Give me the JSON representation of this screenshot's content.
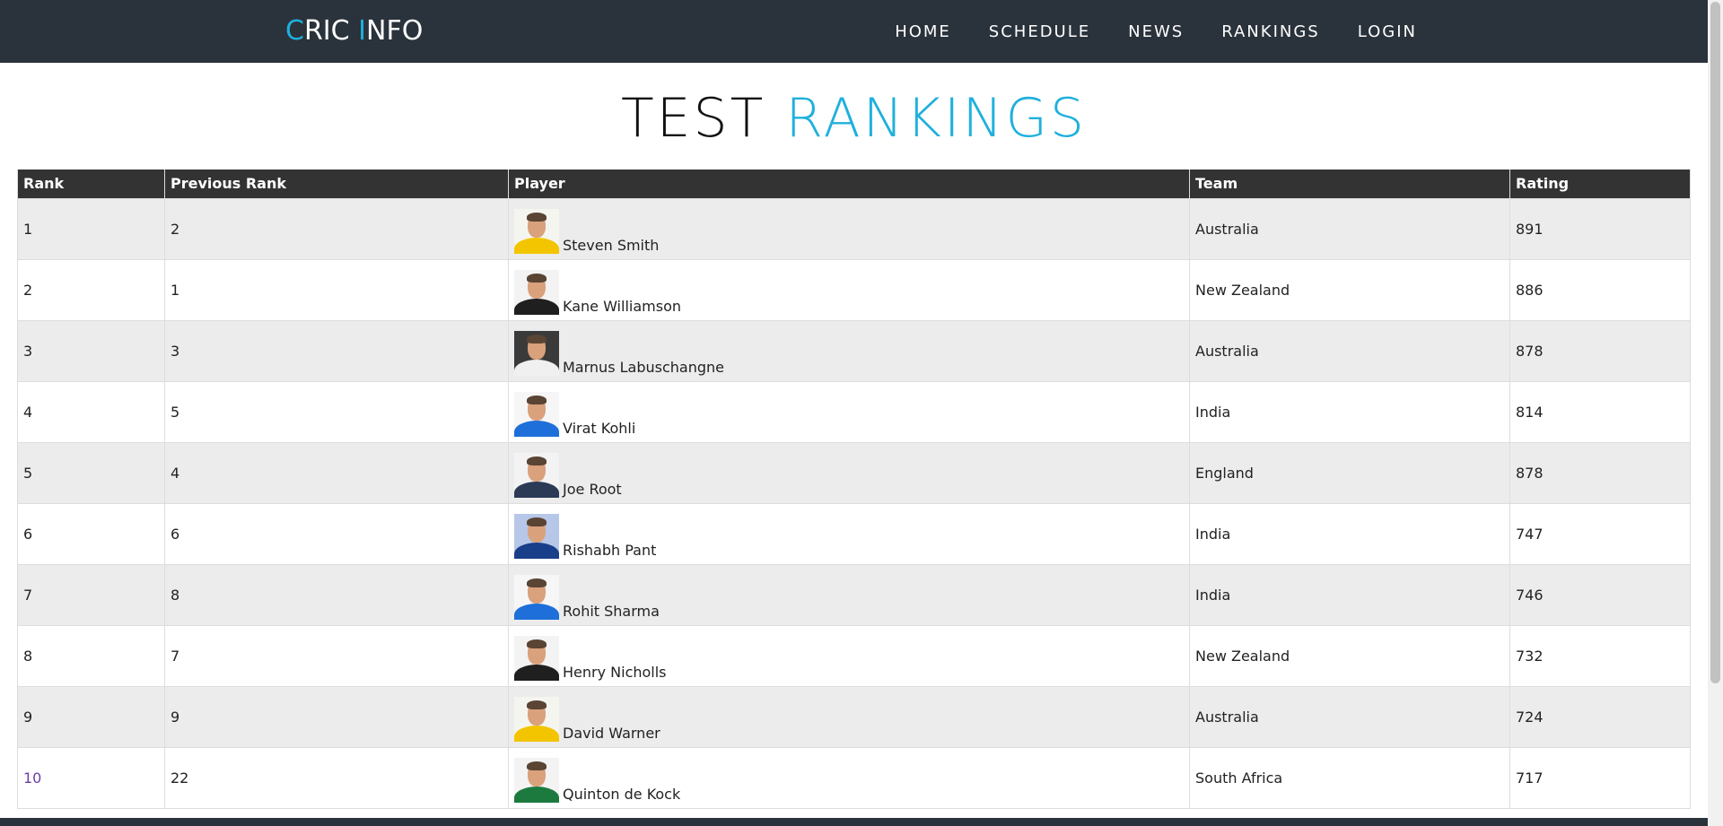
{
  "brand": {
    "part1_accent": "C",
    "part1_rest": "RIC ",
    "part2_accent": "I",
    "part2_rest": "NFO"
  },
  "nav": {
    "items": [
      "HOME",
      "SCHEDULE",
      "NEWS",
      "RANKINGS",
      "LOGIN"
    ]
  },
  "title": {
    "prefix": "TEST ",
    "accent": "RANKINGS"
  },
  "table": {
    "headers": [
      "Rank",
      "Previous Rank",
      "Player",
      "Team",
      "Rating"
    ],
    "rows": [
      {
        "rank": "1",
        "previous_rank": "2",
        "player": "Steven Smith",
        "team": "Australia",
        "rating": "891",
        "avatar_shirt": "#f2c500",
        "avatar_bg": "#f5f5f0"
      },
      {
        "rank": "2",
        "previous_rank": "1",
        "player": "Kane Williamson",
        "team": "New Zealand",
        "rating": "886",
        "avatar_shirt": "#1f1f1f",
        "avatar_bg": "#f3f3f3"
      },
      {
        "rank": "3",
        "previous_rank": "3",
        "player": "Marnus Labuschangne",
        "team": "Australia",
        "rating": "878",
        "avatar_shirt": "#f0f0f0",
        "avatar_bg": "#3a3a3a"
      },
      {
        "rank": "4",
        "previous_rank": "5",
        "player": "Virat Kohli",
        "team": "India",
        "rating": "814",
        "avatar_shirt": "#1e6fd9",
        "avatar_bg": "#f6f6f6"
      },
      {
        "rank": "5",
        "previous_rank": "4",
        "player": "Joe Root",
        "team": "England",
        "rating": "878",
        "avatar_shirt": "#2b3a55",
        "avatar_bg": "#f3f3f3"
      },
      {
        "rank": "6",
        "previous_rank": "6",
        "player": "Rishabh Pant",
        "team": "India",
        "rating": "747",
        "avatar_shirt": "#1a3f8a",
        "avatar_bg": "#b7c7e8"
      },
      {
        "rank": "7",
        "previous_rank": "8",
        "player": "Rohit Sharma",
        "team": "India",
        "rating": "746",
        "avatar_shirt": "#1e6fd9",
        "avatar_bg": "#f6f6f6"
      },
      {
        "rank": "8",
        "previous_rank": "7",
        "player": "Henry Nicholls",
        "team": "New Zealand",
        "rating": "732",
        "avatar_shirt": "#1f1f1f",
        "avatar_bg": "#f3f3f3"
      },
      {
        "rank": "9",
        "previous_rank": "9",
        "player": "David Warner",
        "team": "Australia",
        "rating": "724",
        "avatar_shirt": "#f2c500",
        "avatar_bg": "#f5f5f0"
      },
      {
        "rank": "10",
        "previous_rank": "22",
        "player": "Quinton de Kock",
        "team": "South Africa",
        "rating": "717",
        "avatar_shirt": "#1c7a3e",
        "avatar_bg": "#f3f3f3"
      }
    ]
  }
}
